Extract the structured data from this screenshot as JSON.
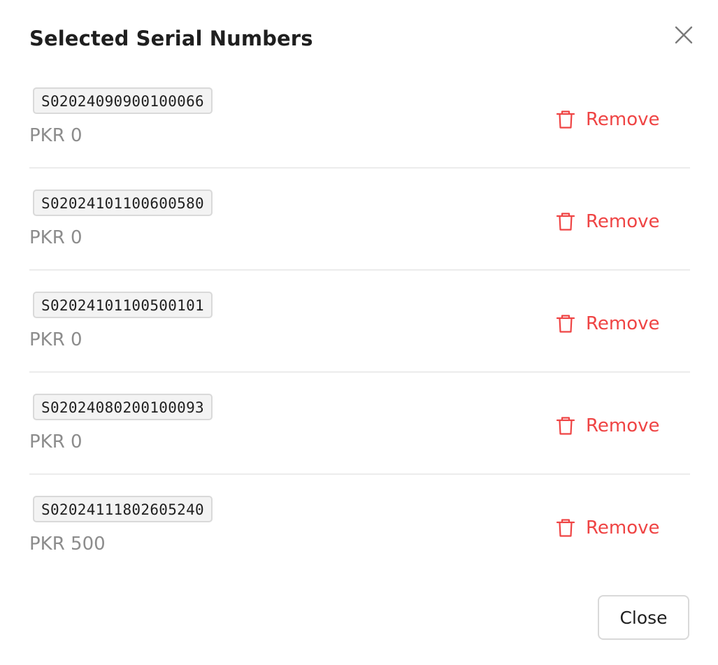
{
  "modal": {
    "title": "Selected Serial Numbers",
    "close_icon": "close-icon",
    "close_button_label": "Close"
  },
  "items": [
    {
      "serial": "S02024090900100066",
      "price": "PKR 0",
      "remove_label": "Remove"
    },
    {
      "serial": "S02024101100600580",
      "price": "PKR 0",
      "remove_label": "Remove"
    },
    {
      "serial": "S02024101100500101",
      "price": "PKR 0",
      "remove_label": "Remove"
    },
    {
      "serial": "S02024080200100093",
      "price": "PKR 0",
      "remove_label": "Remove"
    },
    {
      "serial": "S02024111802605240",
      "price": "PKR 500",
      "remove_label": "Remove"
    }
  ],
  "colors": {
    "danger": "#ef4444",
    "muted_text": "#8c8c8c",
    "tag_background": "#f3f3f3",
    "border": "#d9d9d9"
  },
  "icons": {
    "remove": "trash-icon",
    "close": "close-icon"
  }
}
